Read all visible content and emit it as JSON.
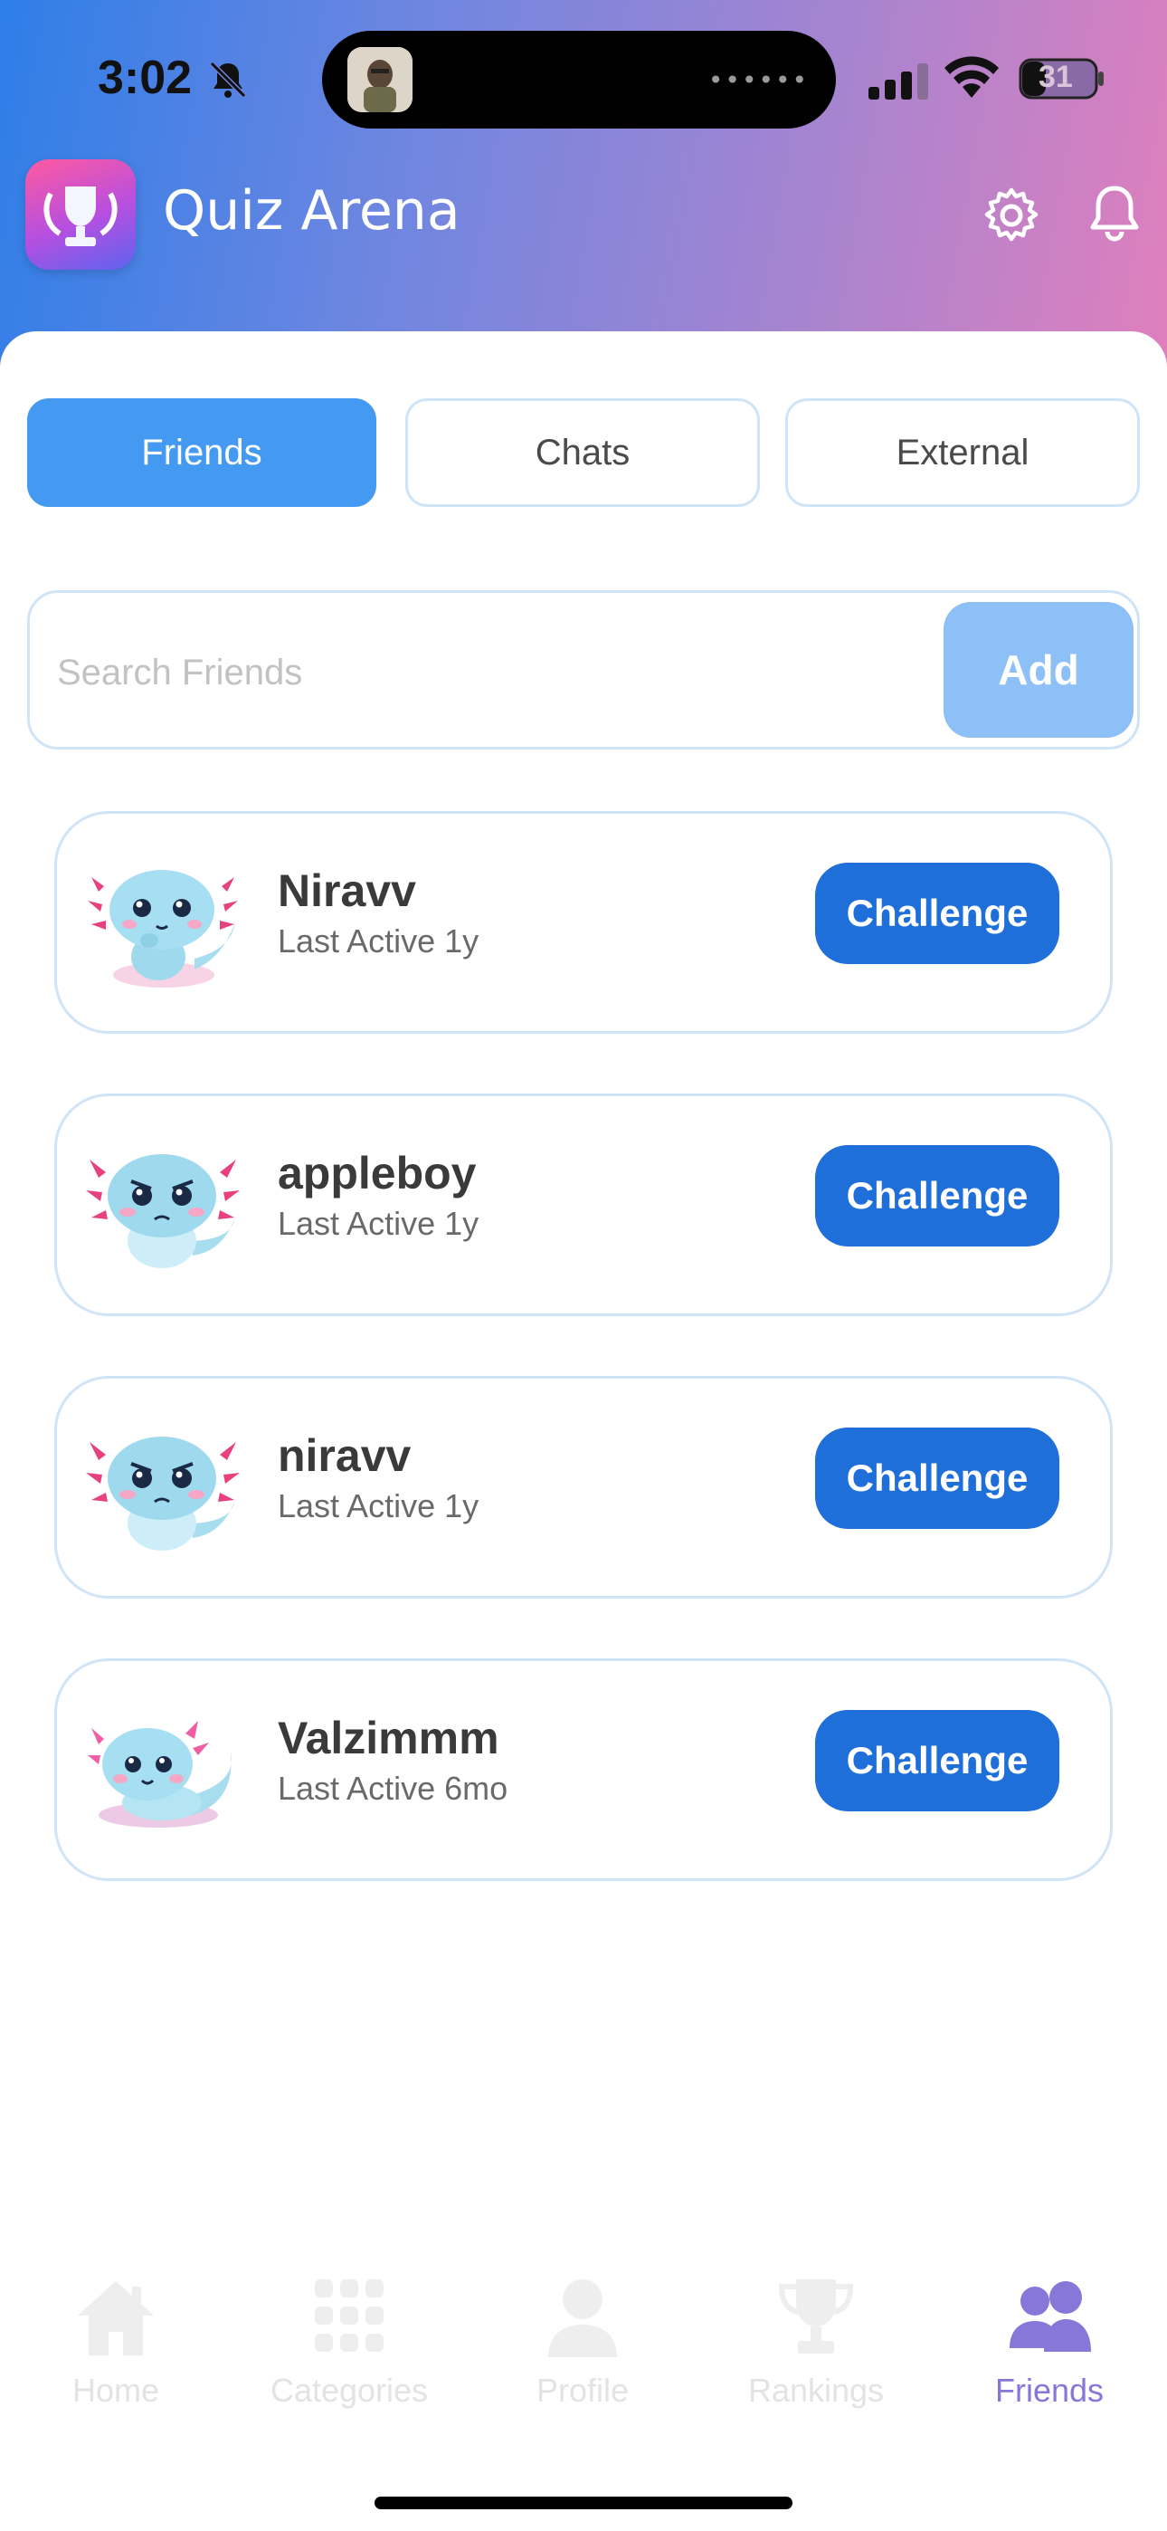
{
  "status_bar": {
    "time": "3:02",
    "battery": "31",
    "island_dots": "••••••"
  },
  "header": {
    "title": "Quiz Arena",
    "icons": [
      "trophy-logo",
      "settings-icon",
      "bell-icon"
    ]
  },
  "tabs": [
    {
      "label": "Friends",
      "active": true
    },
    {
      "label": "Chats",
      "active": false
    },
    {
      "label": "External",
      "active": false
    }
  ],
  "search": {
    "placeholder": "Search Friends",
    "value": "",
    "add_label": "Add"
  },
  "friends": [
    {
      "name": "Niravv",
      "last_active": "Last Active 1y",
      "button": "Challenge",
      "avatar": "axolotl-thinking"
    },
    {
      "name": "appleboy",
      "last_active": "Last Active 1y",
      "button": "Challenge",
      "avatar": "axolotl-grumpy"
    },
    {
      "name": "niravv",
      "last_active": "Last Active 1y",
      "button": "Challenge",
      "avatar": "axolotl-grumpy"
    },
    {
      "name": "Valzimmm",
      "last_active": "Last Active 6mo",
      "button": "Challenge",
      "avatar": "axolotl-happy"
    }
  ],
  "bottom_nav": [
    {
      "label": "Home",
      "icon": "home-icon",
      "active": false
    },
    {
      "label": "Categories",
      "icon": "grid-icon",
      "active": false
    },
    {
      "label": "Profile",
      "icon": "user-icon",
      "active": false
    },
    {
      "label": "Rankings",
      "icon": "trophy-icon",
      "active": false
    },
    {
      "label": "Friends",
      "icon": "friends-icon",
      "active": true
    }
  ],
  "colors": {
    "primary": "#1f6fdb",
    "tab_active": "#4499f0",
    "add_button": "#8ec0f8",
    "border": "#cfe4f7",
    "nav_active": "#8677d9"
  }
}
